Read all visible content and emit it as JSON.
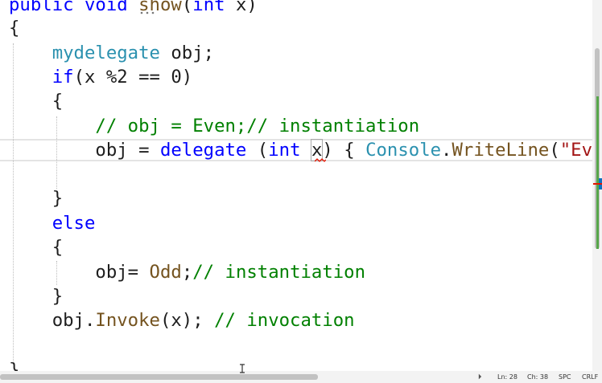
{
  "colors": {
    "keyword": "#0000ff",
    "type": "#2b91af",
    "comment": "#008000",
    "method": "#74531f",
    "string": "#a31515",
    "plain": "#1e1e1e",
    "error_squiggle": "#e51400"
  },
  "code": {
    "line1": {
      "kw1": "public",
      "kw2": "void",
      "method": "show",
      "kw3": "int",
      "param": "x",
      "rest": ")"
    },
    "line2": "{",
    "line3": {
      "type": "mydelegate",
      "rest": " obj;"
    },
    "line4": {
      "kw": "if",
      "rest": "(x %2 == 0)"
    },
    "line5": "{",
    "line6": "// obj = Even;// instantiation",
    "line7": {
      "a": "obj = ",
      "kw1": "delegate",
      "b": " (",
      "kw2": "int",
      "c": " ",
      "param": "x",
      "d": ") { ",
      "type": "Console",
      "e": ".",
      "method": "WriteLine",
      "f": "(",
      "string": "\"Ev"
    },
    "line9": "}",
    "line10": "else",
    "line11": "{",
    "line12": {
      "a": "obj= ",
      "method": "Odd",
      "b": ";",
      "comment": "// instantiation"
    },
    "line13": "}",
    "line14": {
      "a": "obj.",
      "method": "Invoke",
      "b": "(x); ",
      "comment": "// invocation"
    },
    "line16": "}"
  },
  "statusbar": {
    "line": "Ln: 28",
    "col": "Ch: 38",
    "whitespace": "SPC",
    "line_ending": "CRLF"
  }
}
